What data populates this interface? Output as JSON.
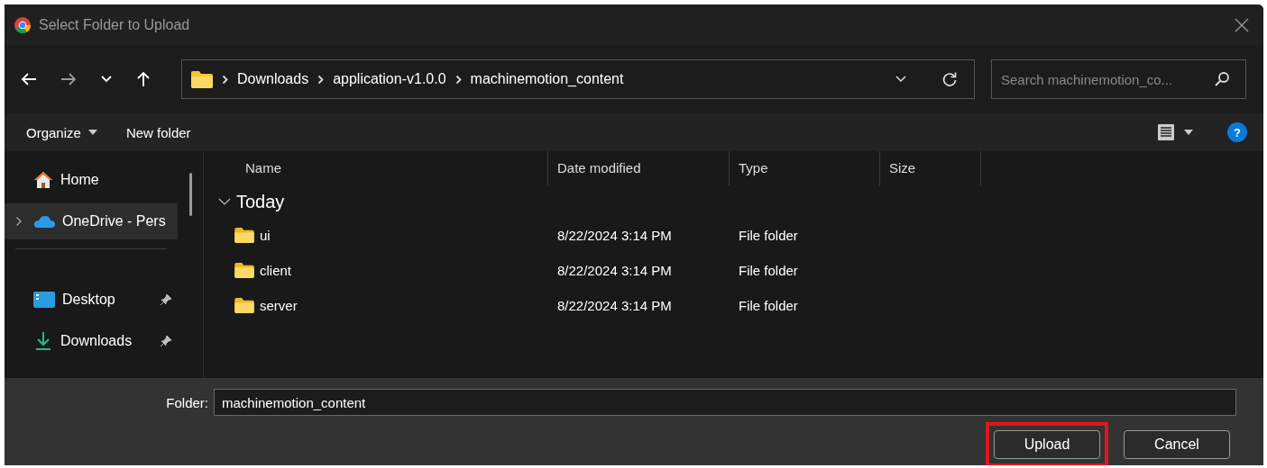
{
  "window": {
    "title": "Select Folder to Upload"
  },
  "breadcrumb": [
    "Downloads",
    "application-v1.0.0",
    "machinemotion_content"
  ],
  "search": {
    "placeholder": "Search machinemotion_co..."
  },
  "toolbar": {
    "organize": "Organize",
    "new_folder": "New folder",
    "help": "?"
  },
  "sidebar": {
    "items": [
      {
        "kind": "home",
        "label": "Home",
        "selected": false,
        "expandable": false,
        "pinned": false
      },
      {
        "kind": "cloud",
        "label": "OneDrive - Pers",
        "selected": true,
        "expandable": true,
        "pinned": false
      },
      {
        "kind": "divider"
      },
      {
        "kind": "desktop",
        "label": "Desktop",
        "selected": false,
        "expandable": false,
        "pinned": true
      },
      {
        "kind": "download",
        "label": "Downloads",
        "selected": false,
        "expandable": false,
        "pinned": true
      }
    ]
  },
  "table": {
    "columns": [
      "Name",
      "Date modified",
      "Type",
      "Size"
    ],
    "group": {
      "label": "Today",
      "expanded": true
    },
    "rows": [
      {
        "name": "ui",
        "date": "8/22/2024 3:14 PM",
        "type": "File folder"
      },
      {
        "name": "client",
        "date": "8/22/2024 3:14 PM",
        "type": "File folder"
      },
      {
        "name": "server",
        "date": "8/22/2024 3:14 PM",
        "type": "File folder"
      }
    ]
  },
  "folder_field": {
    "label": "Folder:",
    "value": "machinemotion_content"
  },
  "buttons": [
    {
      "label": "Upload",
      "highlighted": true
    },
    {
      "label": "Cancel",
      "highlighted": false
    }
  ]
}
